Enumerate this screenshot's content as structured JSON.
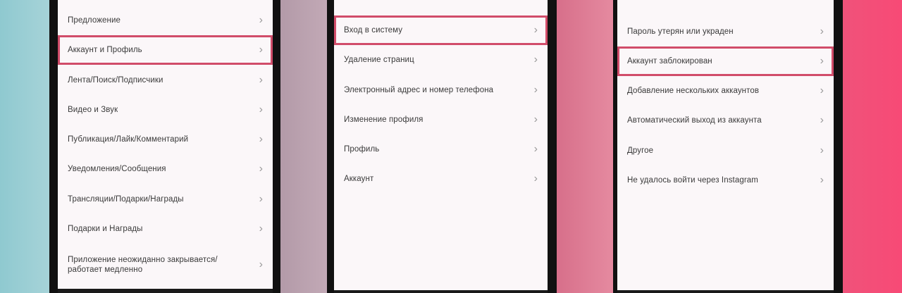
{
  "panels": [
    {
      "items": [
        {
          "label": "Предложение",
          "highlighted": false
        },
        {
          "label": "Аккаунт и Профиль",
          "highlighted": true
        },
        {
          "label": "Лента/Поиск/Подписчики",
          "highlighted": false
        },
        {
          "label": "Видео и Звук",
          "highlighted": false
        },
        {
          "label": "Публикация/Лайк/Комментарий",
          "highlighted": false
        },
        {
          "label": "Уведомления/Сообщения",
          "highlighted": false
        },
        {
          "label": "Трансляции/Подарки/Награды",
          "highlighted": false
        },
        {
          "label": "Подарки и Награды",
          "highlighted": false
        },
        {
          "label": "Приложение неожиданно закрывается/ работает медленно",
          "highlighted": false
        }
      ]
    },
    {
      "items": [
        {
          "label": "Вход в систему",
          "highlighted": true
        },
        {
          "label": "Удаление страниц",
          "highlighted": false
        },
        {
          "label": "Электронный адрес и номер телефона",
          "highlighted": false
        },
        {
          "label": "Изменение профиля",
          "highlighted": false
        },
        {
          "label": "Профиль",
          "highlighted": false
        },
        {
          "label": "Аккаунт",
          "highlighted": false
        }
      ]
    },
    {
      "items": [
        {
          "label": "Пароль утерян или украден",
          "highlighted": false
        },
        {
          "label": "Аккаунт заблокирован",
          "highlighted": true
        },
        {
          "label": "Добавление нескольких аккаунтов",
          "highlighted": false
        },
        {
          "label": "Автоматический выход из аккаунта",
          "highlighted": false
        },
        {
          "label": "Другое",
          "highlighted": false
        },
        {
          "label": "Не удалось войти через Instagram",
          "highlighted": false
        }
      ]
    }
  ],
  "chevron": "›"
}
